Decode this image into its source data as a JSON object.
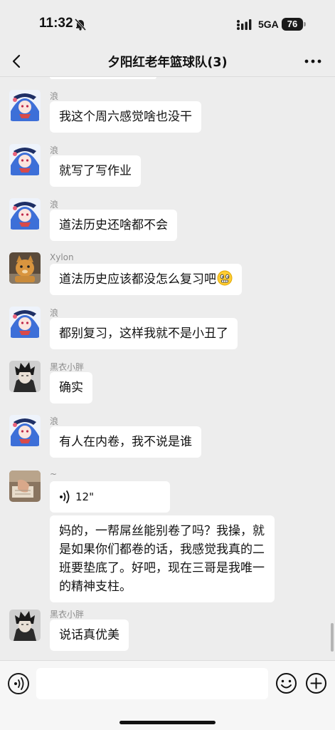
{
  "status": {
    "time": "11:32",
    "network": "5GA",
    "battery": "76"
  },
  "chat": {
    "title": "夕阳红老年篮球队(3)"
  },
  "messages": [
    {
      "sender": "浪",
      "text": "我这个周六感觉啥也没干"
    },
    {
      "sender": "浪",
      "text": "就写了写作业"
    },
    {
      "sender": "浪",
      "text": "道法历史还啥都不会"
    },
    {
      "sender": "Xylon",
      "text": "道法历史应该都没怎么复习吧"
    },
    {
      "sender": "浪",
      "text": "都别复习，这样我就不是小丑了"
    },
    {
      "sender": "黑衣小胖",
      "text": "确实"
    },
    {
      "sender": "浪",
      "text": "有人在内卷，我不说是谁"
    },
    {
      "sender": "~",
      "voice_duration": "12\"",
      "text": "妈的，一帮屌丝能别卷了吗？我操，就是如果你们都卷的话，我感觉我真的二班要垫底了。好吧，现在三哥是我唯一的精神支柱。"
    },
    {
      "sender": "黑衣小胖",
      "text": "说话真优美"
    }
  ],
  "icons": {
    "back": "chevron-left-icon",
    "more": "more-dots-icon",
    "voice": "voice-wave-icon",
    "emoji": "smiley-icon",
    "plus": "plus-circle-icon",
    "mute": "bell-slash-icon"
  },
  "colors": {
    "background": "#ededed",
    "bubble": "#ffffff",
    "sender_text": "#8c8c8c"
  }
}
